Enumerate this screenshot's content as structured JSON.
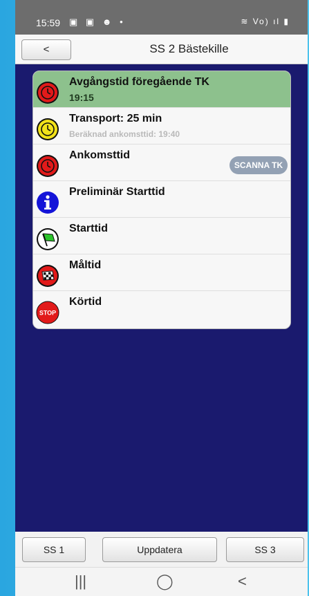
{
  "status_bar": {
    "time": "15:59",
    "notif_icons": "▣ ▣ ☻ •",
    "right_icons": "≋ Vo) ıl ▮"
  },
  "header": {
    "back_label": "<",
    "title": "SS 2 Bästekille"
  },
  "rows": [
    {
      "label": "Avgångstid föregående TK",
      "sub": "19:15",
      "icon": "red-clock-icon"
    },
    {
      "label": "Transport: 25 min",
      "sub": "Beräknad ankomsttid: 19:40",
      "icon": "yellow-clock-icon"
    },
    {
      "label": "Ankomsttid",
      "button": "SCANNA TK",
      "icon": "red-clock-icon"
    },
    {
      "label": "Preliminär Starttid",
      "icon": "info-icon"
    },
    {
      "label": "Starttid",
      "icon": "green-flag-icon"
    },
    {
      "label": "Måltid",
      "icon": "checkered-flag-icon"
    },
    {
      "label": "Körtid",
      "icon": "stop-icon"
    }
  ],
  "footer": {
    "prev_label": "SS 1",
    "update_label": "Uppdatera",
    "next_label": "SS 3"
  },
  "nav": {
    "recents": "|||",
    "home": "◯",
    "back": "<"
  },
  "colors": {
    "content_bg": "#1a1a6e",
    "active_row": "#8dc18d",
    "scan_button": "#93a1b4"
  }
}
